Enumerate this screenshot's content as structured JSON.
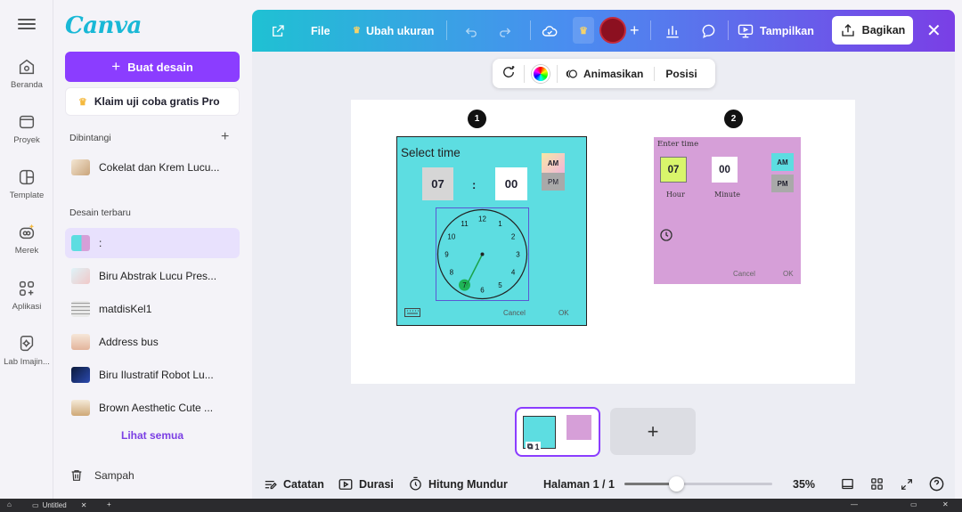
{
  "rail": {
    "items": [
      {
        "label": "Beranda",
        "icon": "home-icon"
      },
      {
        "label": "Proyek",
        "icon": "folder-icon"
      },
      {
        "label": "Template",
        "icon": "template-icon"
      },
      {
        "label": "Merek",
        "icon": "brand-icon"
      },
      {
        "label": "Aplikasi",
        "icon": "apps-icon"
      },
      {
        "label": "Lab Imajin...",
        "icon": "magic-lab-icon"
      }
    ]
  },
  "sidebar": {
    "logo": "Canva",
    "create_label": "Buat desain",
    "trial_label": "Klaim uji coba gratis Pro",
    "starred_title": "Dibintangi",
    "starred": [
      "Cokelat dan Krem Lucu..."
    ],
    "recent_title": "Desain terbaru",
    "recent": [
      ":",
      "Biru Abstrak Lucu Pres...",
      "matdisKel1",
      "Address bus",
      "Biru Ilustratif Robot Lu...",
      "Brown Aesthetic Cute ..."
    ],
    "see_all": "Lihat semua",
    "trash": "Sampah"
  },
  "topbar": {
    "file": "File",
    "resize": "Ubah ukuran",
    "present": "Tampilkan",
    "share": "Bagikan"
  },
  "floatbar": {
    "animate": "Animasikan",
    "position": "Posisi"
  },
  "canvas": {
    "badge1": "1",
    "badge2": "2",
    "picker1": {
      "title": "Select time",
      "hour": "07",
      "colon": ":",
      "minute": "00",
      "am": "AM",
      "pm": "PM",
      "cancel": "Cancel",
      "ok": "OK",
      "clock_numbers": [
        "12",
        "1",
        "2",
        "3",
        "4",
        "5",
        "6",
        "7",
        "8",
        "9",
        "10",
        "11"
      ],
      "selected": "7"
    },
    "picker2": {
      "title": "Enter time",
      "hour": "07",
      "minute": "00",
      "hour_label": "Hour",
      "minute_label": "Minute",
      "am": "AM",
      "pm": "PM",
      "cancel": "Cancel",
      "ok": "OK"
    }
  },
  "pages": {
    "thumb_count": "1",
    "add": "+"
  },
  "bottombar": {
    "notes": "Catatan",
    "duration": "Durasi",
    "countdown": "Hitung Mundur",
    "page": "Halaman 1 / 1",
    "zoom": "35%",
    "zoom_fraction": 0.35
  },
  "taskbar": {
    "tab": "Untitled"
  },
  "colors": {
    "accent": "#8b3dff",
    "picker1_bg": "#5ddde1",
    "picker2_bg": "#d69fd8"
  }
}
